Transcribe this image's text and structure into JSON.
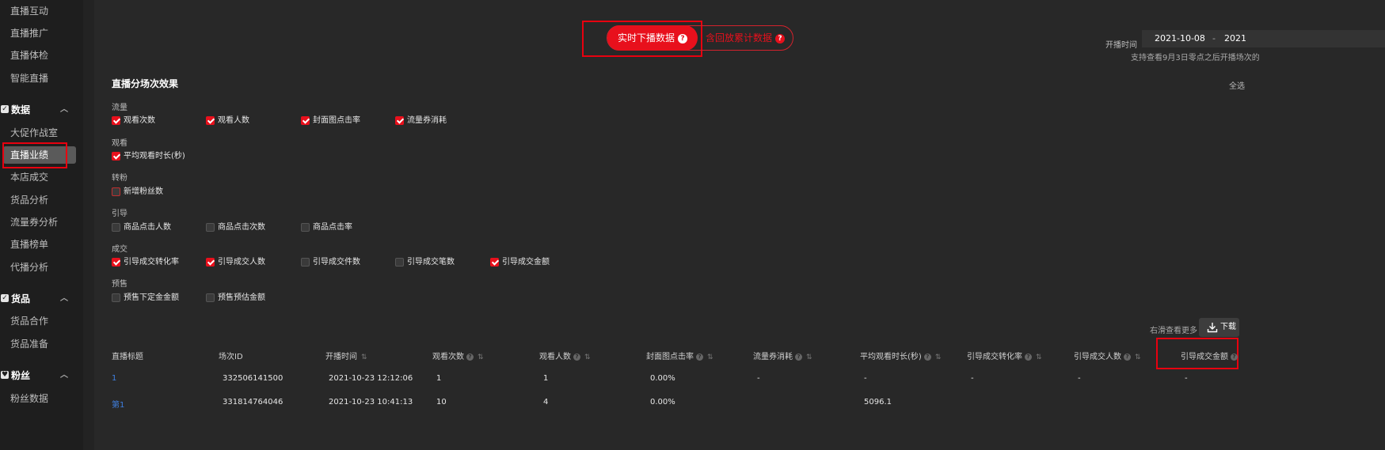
{
  "sidebar": {
    "items_top": [
      {
        "label": "直播互动",
        "active": false
      },
      {
        "label": "直播推广",
        "active": false
      },
      {
        "label": "直播体检",
        "active": false
      },
      {
        "label": "智能直播",
        "active": false
      }
    ],
    "group_data": {
      "label": "数据",
      "icon": "check-square-icon"
    },
    "items_data": [
      {
        "label": "大促作战室",
        "active": false
      },
      {
        "label": "直播业绩",
        "active": true
      },
      {
        "label": "本店成交",
        "active": false
      },
      {
        "label": "货品分析",
        "active": false
      },
      {
        "label": "流量券分析",
        "active": false
      },
      {
        "label": "直播榜单",
        "active": false
      },
      {
        "label": "代播分析",
        "active": false
      }
    ],
    "group_goods": {
      "label": "货品",
      "icon": "check-square-icon"
    },
    "items_goods": [
      {
        "label": "货品合作",
        "active": false
      },
      {
        "label": "货品准备",
        "active": false
      }
    ],
    "group_fans": {
      "label": "粉丝",
      "icon": "fans-icon"
    },
    "items_fans": [
      {
        "label": "粉丝数据",
        "active": false
      }
    ]
  },
  "toggle": {
    "active_label": "实时下播数据",
    "inactive_label": "含回放累计数据"
  },
  "date_filter": {
    "label": "开播时间",
    "start": "2021-10-08",
    "separator": "-",
    "end": "2021",
    "note": "支持查看9月3日零点之后开播场次的"
  },
  "section": {
    "title": "直播分场次效果",
    "select_all": "全选"
  },
  "metric_groups": [
    {
      "label": "流量",
      "items": [
        {
          "label": "观看次数",
          "checked": true
        },
        {
          "label": "观看人数",
          "checked": true
        },
        {
          "label": "封面图点击率",
          "checked": true
        },
        {
          "label": "流量券消耗",
          "checked": true
        }
      ]
    },
    {
      "label": "观看",
      "items": [
        {
          "label": "平均观看时长(秒)",
          "checked": true
        }
      ]
    },
    {
      "label": "转粉",
      "items": [
        {
          "label": "新增粉丝数",
          "checked": false
        }
      ]
    },
    {
      "label": "引导",
      "items": [
        {
          "label": "商品点击人数",
          "checked": false
        },
        {
          "label": "商品点击次数",
          "checked": false
        },
        {
          "label": "商品点击率",
          "checked": false
        }
      ]
    },
    {
      "label": "成交",
      "items": [
        {
          "label": "引导成交转化率",
          "checked": true
        },
        {
          "label": "引导成交人数",
          "checked": true
        },
        {
          "label": "引导成交件数",
          "checked": false
        },
        {
          "label": "引导成交笔数",
          "checked": false
        },
        {
          "label": "引导成交金额",
          "checked": true
        }
      ]
    },
    {
      "label": "预售",
      "items": [
        {
          "label": "预售下定金金额",
          "checked": false
        },
        {
          "label": "预售预估金额",
          "checked": false
        }
      ]
    }
  ],
  "table": {
    "scroll_hint": "右滑查看更多",
    "download_label": "下载",
    "columns": [
      {
        "label": "直播标题",
        "help": false,
        "sort": false
      },
      {
        "label": "场次ID",
        "help": false,
        "sort": false
      },
      {
        "label": "开播时间",
        "help": false,
        "sort": true
      },
      {
        "label": "观看次数",
        "help": true,
        "sort": true
      },
      {
        "label": "观看人数",
        "help": true,
        "sort": true
      },
      {
        "label": "封面图点击率",
        "help": true,
        "sort": true
      },
      {
        "label": "流量券消耗",
        "help": true,
        "sort": true
      },
      {
        "label": "平均观看时长(秒)",
        "help": true,
        "sort": true
      },
      {
        "label": "引导成交转化率",
        "help": true,
        "sort": true
      },
      {
        "label": "引导成交人数",
        "help": true,
        "sort": true
      },
      {
        "label": "引导成交金额",
        "help": true,
        "sort": false
      }
    ],
    "rows": [
      [
        "1",
        "332506141500",
        "2021-10-23 12:12:06",
        "1",
        "1",
        "0.00%",
        "-",
        "-",
        "-",
        "-",
        "-"
      ],
      [
        "第1",
        "331814764046",
        "2021-10-23 10:41:13",
        "10",
        "4",
        "0.00%",
        "",
        "5096.1",
        "",
        "",
        ""
      ]
    ]
  }
}
